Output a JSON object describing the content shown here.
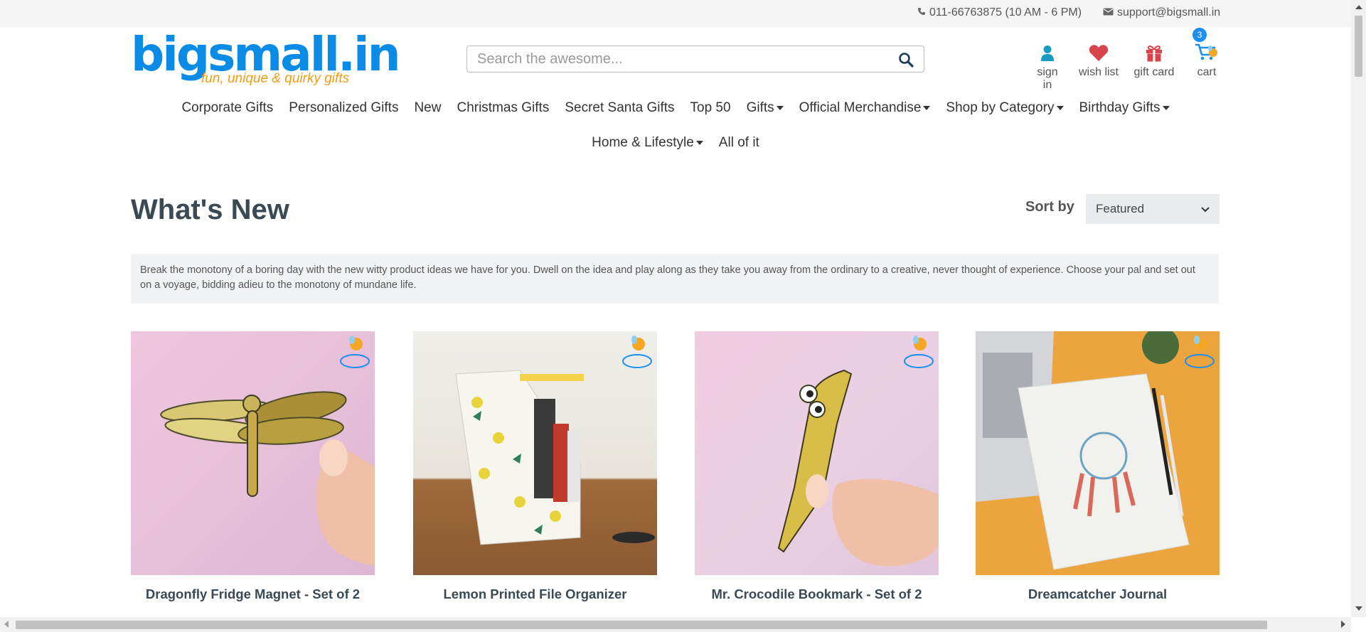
{
  "topbar": {
    "phone": "011-66763875 (10 AM - 6 PM)",
    "email": "support@bigsmall.in"
  },
  "header": {
    "logo_text": "bigsmall.in",
    "tagline": "fun, unique & quirky gifts",
    "search_placeholder": "Search the awesome...",
    "links": {
      "sign_in": "sign in",
      "wish_list": "wish list",
      "gift_card": "gift card",
      "cart": "cart"
    },
    "cart_count": "3"
  },
  "nav": {
    "row1": [
      {
        "label": "Corporate Gifts"
      },
      {
        "label": "Personalized Gifts"
      },
      {
        "label": "New"
      },
      {
        "label": "Christmas Gifts"
      },
      {
        "label": "Secret Santa Gifts"
      },
      {
        "label": "Top 50"
      },
      {
        "label": "Gifts"
      },
      {
        "label": "Official Merchandise"
      },
      {
        "label": "Shop by Category"
      },
      {
        "label": "Birthday Gifts"
      }
    ],
    "row2": [
      {
        "label": "Home & Lifestyle"
      },
      {
        "label": "All of it"
      }
    ]
  },
  "main": {
    "title": "What's New",
    "sort_label": "Sort by",
    "sort_value": "Featured",
    "description": "Break the monotony of a boring day with the new witty product ideas we have for you. Dwell on the idea and play along as they take you away from the ordinary to a creative, never thought of experience. Choose your pal and set out on a voyage, bidding adieu to the monotony of mundane life.",
    "products": [
      {
        "title": "Dragonfly Fridge Magnet - Set of 2"
      },
      {
        "title": "Lemon Printed File Organizer"
      },
      {
        "title": "Mr. Crocodile Bookmark - Set of 2"
      },
      {
        "title": "Dreamcatcher Journal"
      }
    ]
  },
  "colors": {
    "brand_blue": "#0a8be6",
    "brand_orange": "#f39c12",
    "accent_teal": "#1a9bc2",
    "accent_red": "#d9434b"
  },
  "icons": {
    "phone": "phone-icon",
    "email": "envelope-icon",
    "search": "search-icon",
    "sign_in": "user-icon",
    "wish_list": "heart-icon",
    "gift_card": "gift-icon",
    "cart": "cart-icon"
  }
}
